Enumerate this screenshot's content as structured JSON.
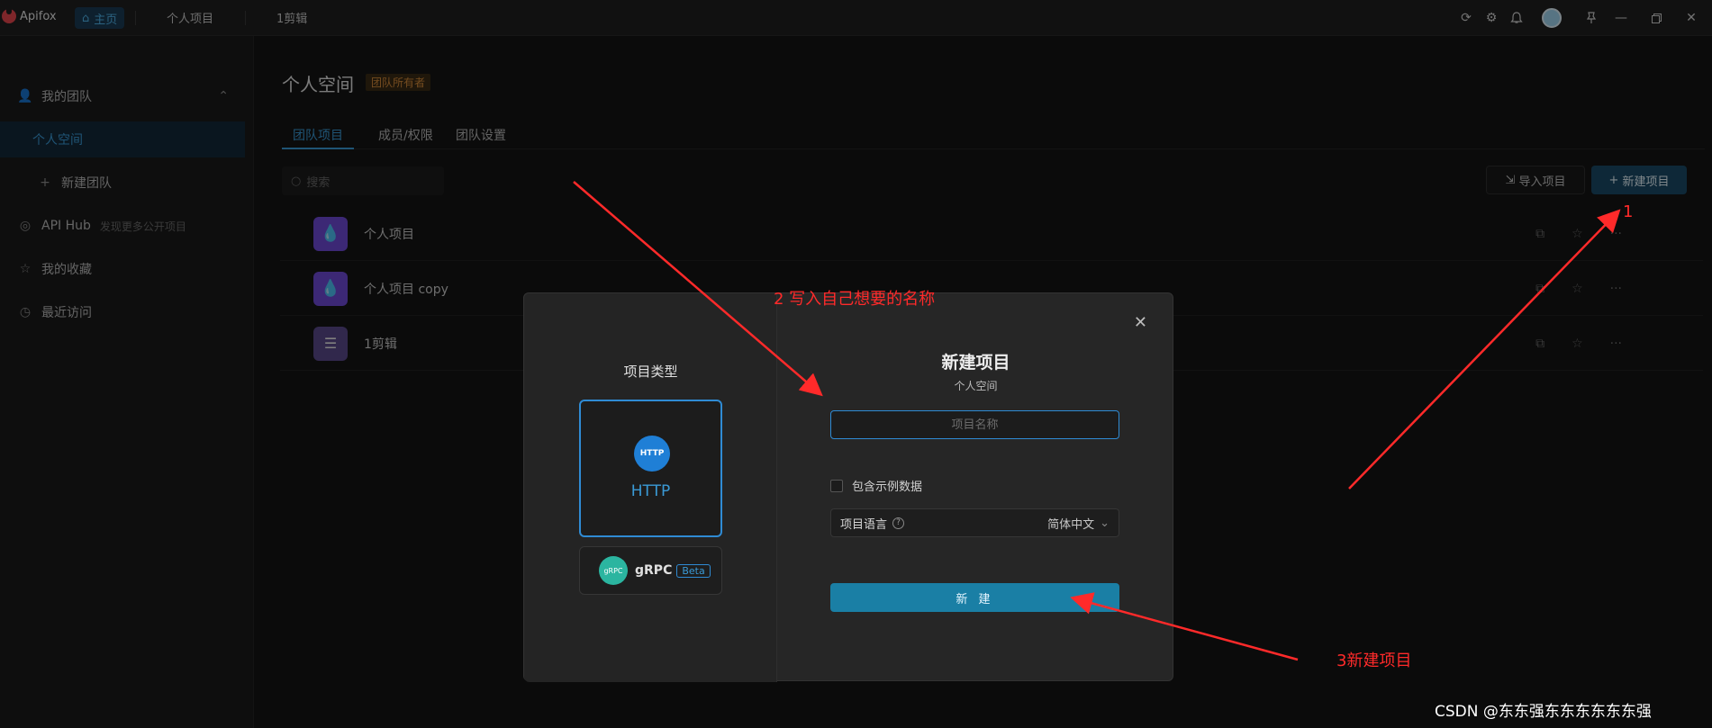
{
  "titlebar": {
    "app_name": "Apifox",
    "tabs": [
      {
        "label": "主页",
        "icon": "home-icon",
        "active": true
      },
      {
        "label": "个人项目"
      },
      {
        "label": "1剪辑"
      }
    ],
    "right_icons": [
      "sync-icon",
      "gear-icon",
      "bell-icon",
      "avatar",
      "pin-icon",
      "minimize-icon",
      "restore-icon",
      "close-icon"
    ]
  },
  "sidebar": {
    "items": [
      {
        "label": "我的团队",
        "icon": "team-icon"
      },
      {
        "label": "个人空间",
        "active": true
      },
      {
        "label": "新建团队",
        "icon": "plus-icon"
      },
      {
        "label": "API Hub",
        "sub": "发现更多公开项目",
        "icon": "compass-icon"
      },
      {
        "label": "我的收藏",
        "icon": "star-icon"
      },
      {
        "label": "最近访问",
        "icon": "clock-icon"
      }
    ]
  },
  "main": {
    "title": "个人空间",
    "badge": "团队所有者",
    "tabs": [
      "团队项目",
      "成员/权限",
      "团队设置"
    ],
    "search_placeholder": "搜索",
    "import_label": "导入项目",
    "new_label": "新建项目",
    "projects": [
      {
        "name": "个人项目"
      },
      {
        "name": "个人项目 copy"
      },
      {
        "name": "1剪辑"
      }
    ]
  },
  "modal": {
    "type_title": "项目类型",
    "types": [
      {
        "logo": "HTTP",
        "label": "HTTP",
        "selected": true
      },
      {
        "logo": "gRPC",
        "label": "gRPC",
        "badge": "Beta"
      }
    ],
    "title": "新建项目",
    "subtitle": "个人空间",
    "name_placeholder": "项目名称",
    "sample_label": "包含示例数据",
    "language_label": "项目语言",
    "language_value": "简体中文",
    "create_label": "新 建"
  },
  "annotations": {
    "step1": "1",
    "step2": "2 写入自己想要的名称",
    "step3": "3新建项目",
    "color": "#ff2a2a"
  },
  "watermark": "CSDN @东东强东东东东东东强"
}
